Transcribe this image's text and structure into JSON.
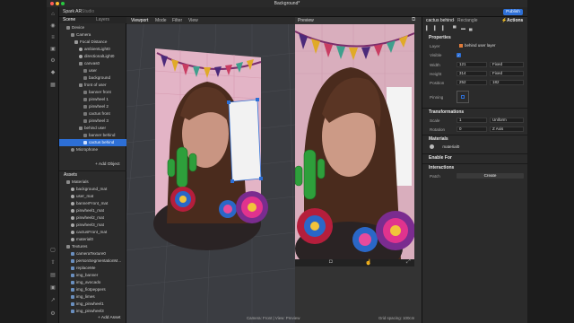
{
  "window": {
    "title": "Background*"
  },
  "brand": {
    "name": "Spark AR",
    "suffix": "Studio"
  },
  "toolbar": {
    "publish_label": "Publish"
  },
  "scene_panel": {
    "tabs": [
      "Scene",
      "Layers"
    ],
    "tree": [
      "Device",
      "Camera",
      "Focal Distance",
      "ambientLight0",
      "directionalLight0",
      "canvas0",
      "user",
      "background",
      "front of user",
      "banner front",
      "pinwheel 1",
      "pinwheel 2",
      "cactus front",
      "pinwheel 3",
      "behind user",
      "banner behind",
      "cactus behind",
      "Microphone"
    ],
    "add_object": "+ Add Object",
    "assets_header": "Assets",
    "assets": [
      "Materials",
      "background_mat",
      "user_mat",
      "bannerFront_mat",
      "pinwheel1_mat",
      "pinwheel2_mat",
      "pinwheel3_mat",
      "cactusFront_mat",
      "material0",
      "Textures",
      "cameraTexture0",
      "personSegmentationM...",
      "replaceMe",
      "img_banner",
      "img_avocado",
      "img_fiotpeppers",
      "img_limes",
      "img_pinwheel1",
      "img_pinwheel3"
    ],
    "add_asset": "+ Add Asset"
  },
  "viewport": {
    "tabs": [
      "Viewport",
      "Mode",
      "Filter",
      "View"
    ],
    "status_center": "Camera: Front | View: Preview",
    "status_right": "Grid spacing: 100cm"
  },
  "preview": {
    "label": "Preview"
  },
  "inspector": {
    "object_name": "cactus behind",
    "object_type": "Rectangle",
    "actions_label": "Actions",
    "properties_header": "Properties",
    "layer_label": "Layer",
    "layer_value": "behind user layer",
    "visible_label": "Visible",
    "width_label": "Width",
    "width_value": "121",
    "width_mode": "Fixed",
    "height_label": "Height",
    "height_value": "314",
    "height_mode": "Fixed",
    "position_label": "Position",
    "position_x": "252",
    "position_y": "182",
    "pinning_label": "Pinning",
    "transformations_header": "Transformations",
    "scale_label": "Scale",
    "scale_value": "1",
    "scale_mode": "Uniform",
    "rotation_label": "Rotation",
    "rotation_value": "0",
    "rotation_axis": "Z Axis",
    "materials_header": "Materials",
    "material_value": "material0",
    "enable_for_header": "Enable For",
    "interactions_header": "Interactions",
    "patch_label": "Patch",
    "create_label": "Create"
  },
  "colors": {
    "accent": "#2d6fd6",
    "panel": "#2b2b2b"
  }
}
